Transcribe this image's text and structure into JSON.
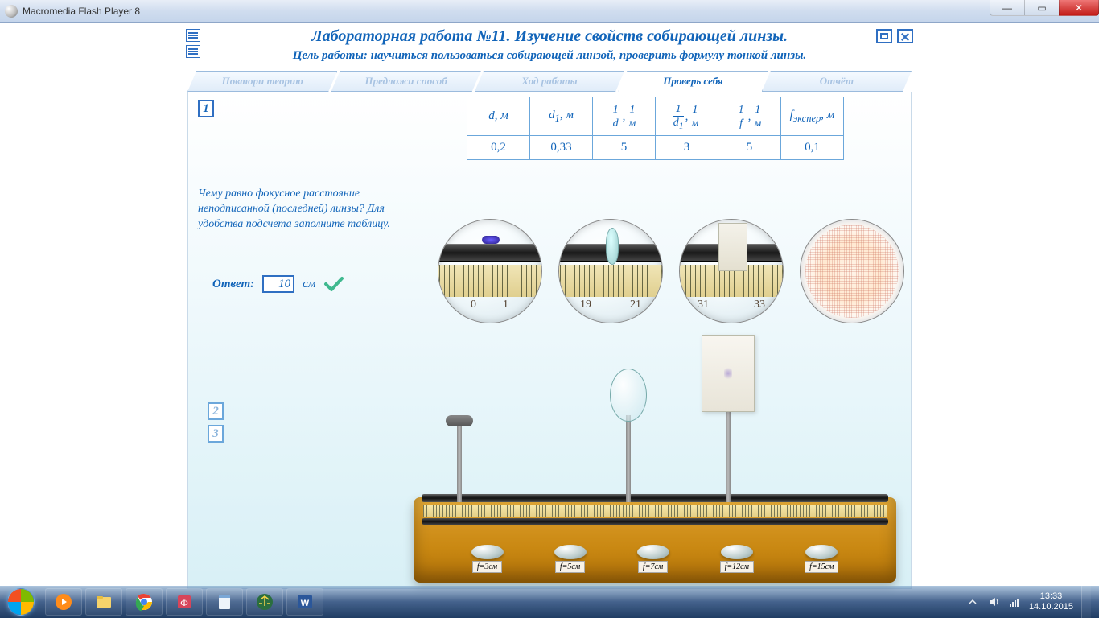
{
  "window": {
    "title": "Macromedia Flash Player 8"
  },
  "header": {
    "title": "Лабораторная работа №11.  Изучение свойств собирающей линзы.",
    "goal": "Цель работы: научиться пользоваться собирающей линзой, проверить формулу тонкой линзы."
  },
  "tabs": [
    {
      "label": "Повтори теорию"
    },
    {
      "label": "Предложи способ"
    },
    {
      "label": "Ход работы"
    },
    {
      "label": "Проверь себя"
    },
    {
      "label": "Отчёт"
    }
  ],
  "active_tab": "Проверь себя",
  "question_numbers": {
    "q1": "1",
    "q2": "2",
    "q3": "3"
  },
  "table": {
    "headers": {
      "d": "d, м",
      "d1": "d₁, м",
      "inv_d": "1/d , 1/м",
      "inv_d1": "1/d₁ , 1/м",
      "inv_f": "1/f , 1/м",
      "f_exp": "fэкспер, м"
    },
    "units": {
      "num": "1",
      "m": "м",
      "d": "d",
      "d1": "d₁",
      "f": "f"
    },
    "row": {
      "d": "0,2",
      "d1": "0,33",
      "inv_d": "5",
      "inv_d1": "3",
      "inv_f": "5",
      "f_exp": "0,1"
    }
  },
  "question": {
    "text": "Чему равно фокусное расстояние неподписанной (последней) линзы? Для удобства подсчета заполните таблицу.",
    "answer_label": "Ответ:",
    "answer_value": "10",
    "answer_unit": "см"
  },
  "magnifiers": {
    "ruler1": {
      "a": "0",
      "b": "1"
    },
    "ruler2": {
      "a": "19",
      "b": "21"
    },
    "ruler3": {
      "a": "31",
      "b": "33"
    }
  },
  "lens_buttons": [
    {
      "label": "f=3см"
    },
    {
      "label": "f=5см"
    },
    {
      "label": "f=7см"
    },
    {
      "label": "f=12см"
    },
    {
      "label": "f=15см"
    }
  ],
  "tray": {
    "time": "13:33",
    "date": "14.10.2015"
  }
}
